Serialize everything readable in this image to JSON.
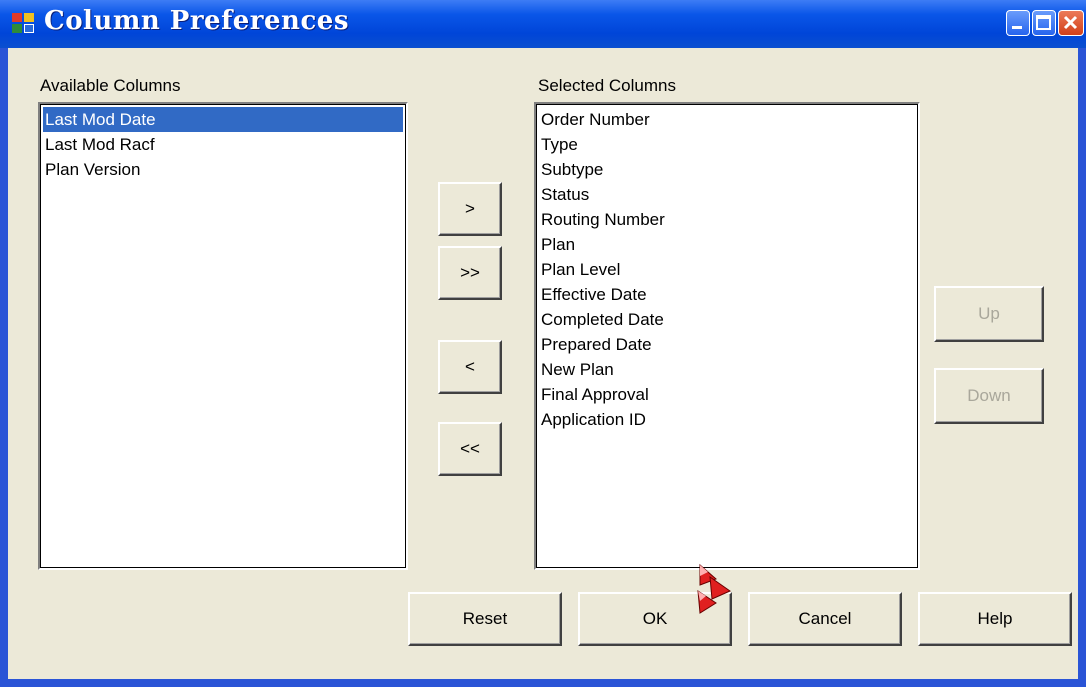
{
  "window": {
    "title": "Column Preferences"
  },
  "available": {
    "label": "Available Columns",
    "items": [
      "Last Mod Date",
      "Last Mod Racf",
      "Plan Version"
    ],
    "selected_index": 0
  },
  "selected": {
    "label": "Selected Columns",
    "items": [
      "Order Number",
      "Type",
      "Subtype",
      "Status",
      "Routing Number",
      "Plan",
      "Plan Level",
      "Effective Date",
      "Completed Date",
      "Prepared Date",
      "New Plan",
      "Final Approval",
      "Application ID"
    ]
  },
  "transfer": {
    "add_one": ">",
    "add_all": ">>",
    "remove_one": "<",
    "remove_all": "<<"
  },
  "order": {
    "up": "Up",
    "down": "Down"
  },
  "footer": {
    "reset": "Reset",
    "ok": "OK",
    "cancel": "Cancel",
    "help": "Help"
  }
}
